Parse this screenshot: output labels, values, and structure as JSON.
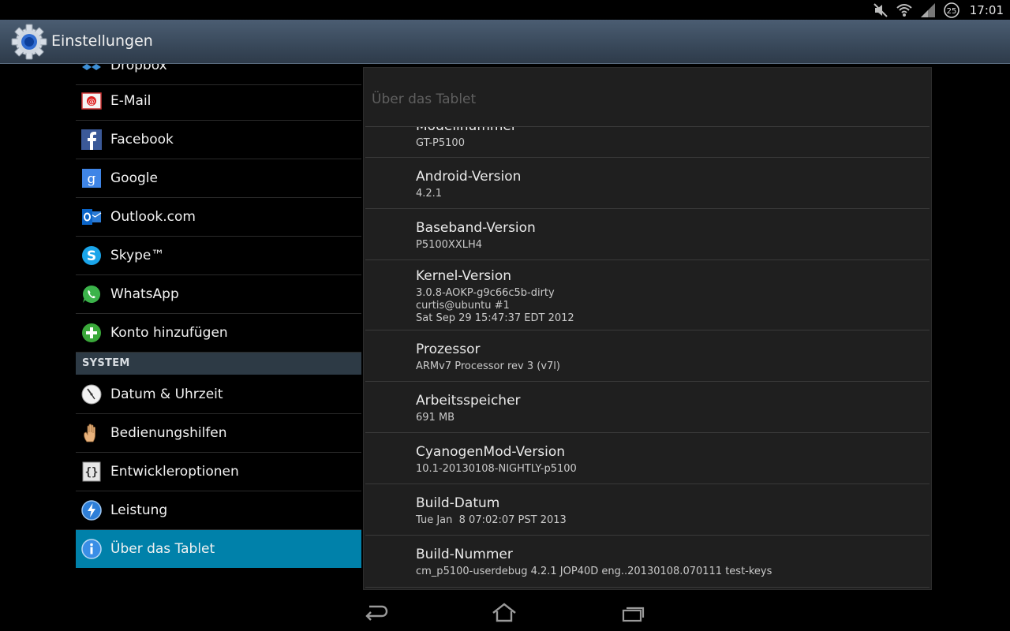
{
  "status_bar": {
    "icons": [
      "mute-icon",
      "wifi-icon",
      "signal-icon",
      "notification-count-icon"
    ],
    "notification_count": "25",
    "time": "17:01"
  },
  "action_bar": {
    "title": "Einstellungen",
    "icon": "settings-gear-icon"
  },
  "sidebar": {
    "items": [
      {
        "label": "Dropbox",
        "icon": "dropbox-icon"
      },
      {
        "label": "E-Mail",
        "icon": "email-icon"
      },
      {
        "label": "Facebook",
        "icon": "facebook-icon"
      },
      {
        "label": "Google",
        "icon": "google-icon"
      },
      {
        "label": "Outlook.com",
        "icon": "outlook-icon"
      },
      {
        "label": "Skype™",
        "icon": "skype-icon"
      },
      {
        "label": "WhatsApp",
        "icon": "whatsapp-icon"
      },
      {
        "label": "Konto hinzufügen",
        "icon": "add-account-icon"
      }
    ],
    "section_header": "SYSTEM",
    "system_items": [
      {
        "label": "Datum & Uhrzeit",
        "icon": "clock-icon"
      },
      {
        "label": "Bedienungshilfen",
        "icon": "hand-icon"
      },
      {
        "label": "Entwickleroptionen",
        "icon": "developer-icon"
      },
      {
        "label": "Leistung",
        "icon": "performance-icon"
      },
      {
        "label": "Über das Tablet",
        "icon": "info-icon",
        "selected": true
      }
    ]
  },
  "detail": {
    "title": "Über das Tablet",
    "items": [
      {
        "title": "Modellnummer",
        "value": [
          "GT-P5100"
        ]
      },
      {
        "title": "Android-Version",
        "value": [
          "4.2.1"
        ]
      },
      {
        "title": "Baseband-Version",
        "value": [
          "P5100XXLH4"
        ]
      },
      {
        "title": "Kernel-Version",
        "value": [
          "3.0.8-AOKP-g9c66c5b-dirty",
          "curtis@ubuntu #1",
          "Sat Sep 29 15:47:37 EDT 2012"
        ]
      },
      {
        "title": "Prozessor",
        "value": [
          "ARMv7 Processor rev 3 (v7l)"
        ]
      },
      {
        "title": "Arbeitsspeicher",
        "value": [
          "691 MB"
        ]
      },
      {
        "title": "CyanogenMod-Version",
        "value": [
          "10.1-20130108-NIGHTLY-p5100"
        ]
      },
      {
        "title": "Build-Datum",
        "value": [
          "Tue Jan  8 07:02:07 PST 2013"
        ]
      },
      {
        "title": "Build-Nummer",
        "value": [
          "cm_p5100-userdebug 4.2.1 JOP40D eng..20130108.070111 test-keys"
        ]
      }
    ]
  },
  "nav_bar": {
    "icons": [
      "back-icon",
      "home-icon",
      "recent-apps-icon"
    ]
  }
}
